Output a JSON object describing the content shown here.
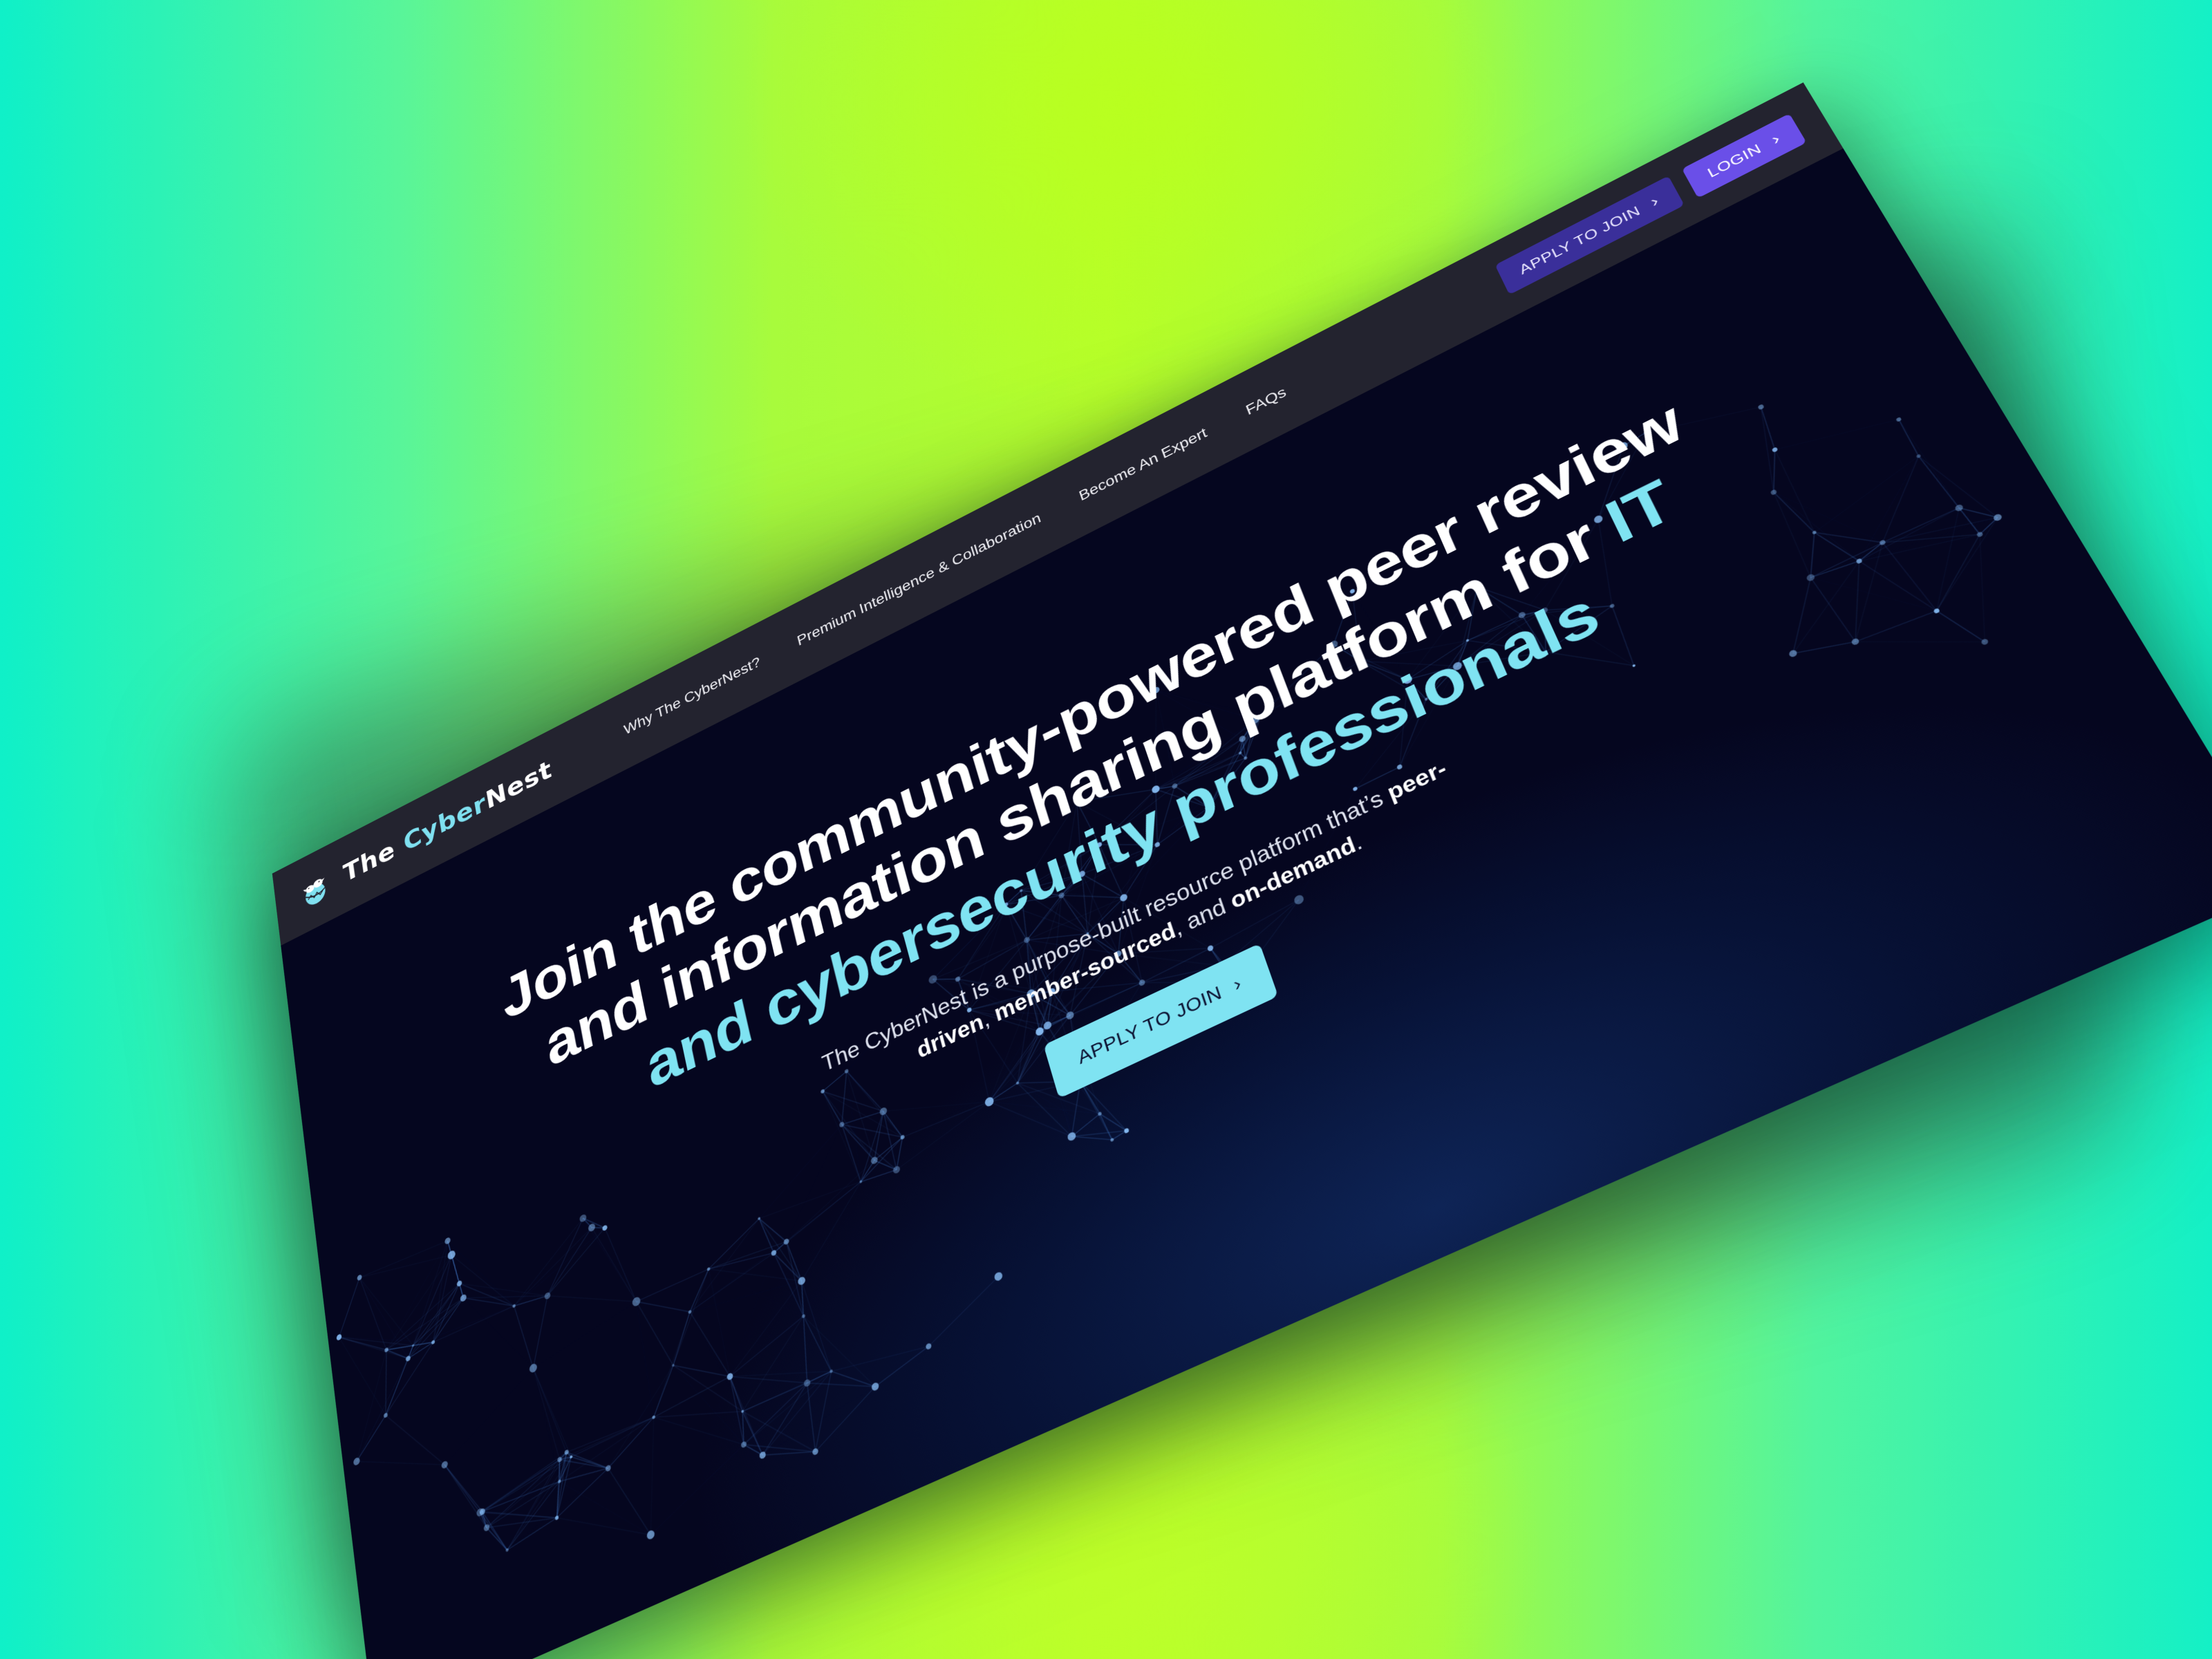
{
  "logo": {
    "prefix": "The ",
    "accent": "Cyber",
    "suffix": "Nest"
  },
  "nav": {
    "items": [
      {
        "label": "Why The CyberNest?"
      },
      {
        "label": "Premium Intelligence & Collaboration"
      },
      {
        "label": "Become An Expert"
      },
      {
        "label": "FAQs"
      }
    ]
  },
  "header_buttons": {
    "apply_label": "APPLY TO JOIN",
    "login_label": "LOGIN"
  },
  "hero": {
    "title_part1": "Join the community-powered peer review and information sharing platform for ",
    "title_highlight": "IT and cybersecurity professionals",
    "subtitle_intro": "The CyberNest is a purpose-built resource platform that’s ",
    "subtitle_b1": "peer-driven",
    "subtitle_sep1": ", ",
    "subtitle_b2": "member-sourced",
    "subtitle_sep2": ", and ",
    "subtitle_b3": "on-demand",
    "subtitle_end": ".",
    "cta_label": "APPLY TO JOIN"
  },
  "colors": {
    "accent_cyan": "#7fe3f2",
    "header_bg": "#23232f",
    "hero_bg": "#05061f",
    "login_purple": "#6a4fe8",
    "apply_purple": "#3a2f9a"
  },
  "icons": {
    "logo": "bird-nest-logo-icon",
    "chevron": "chevron-right-icon"
  }
}
